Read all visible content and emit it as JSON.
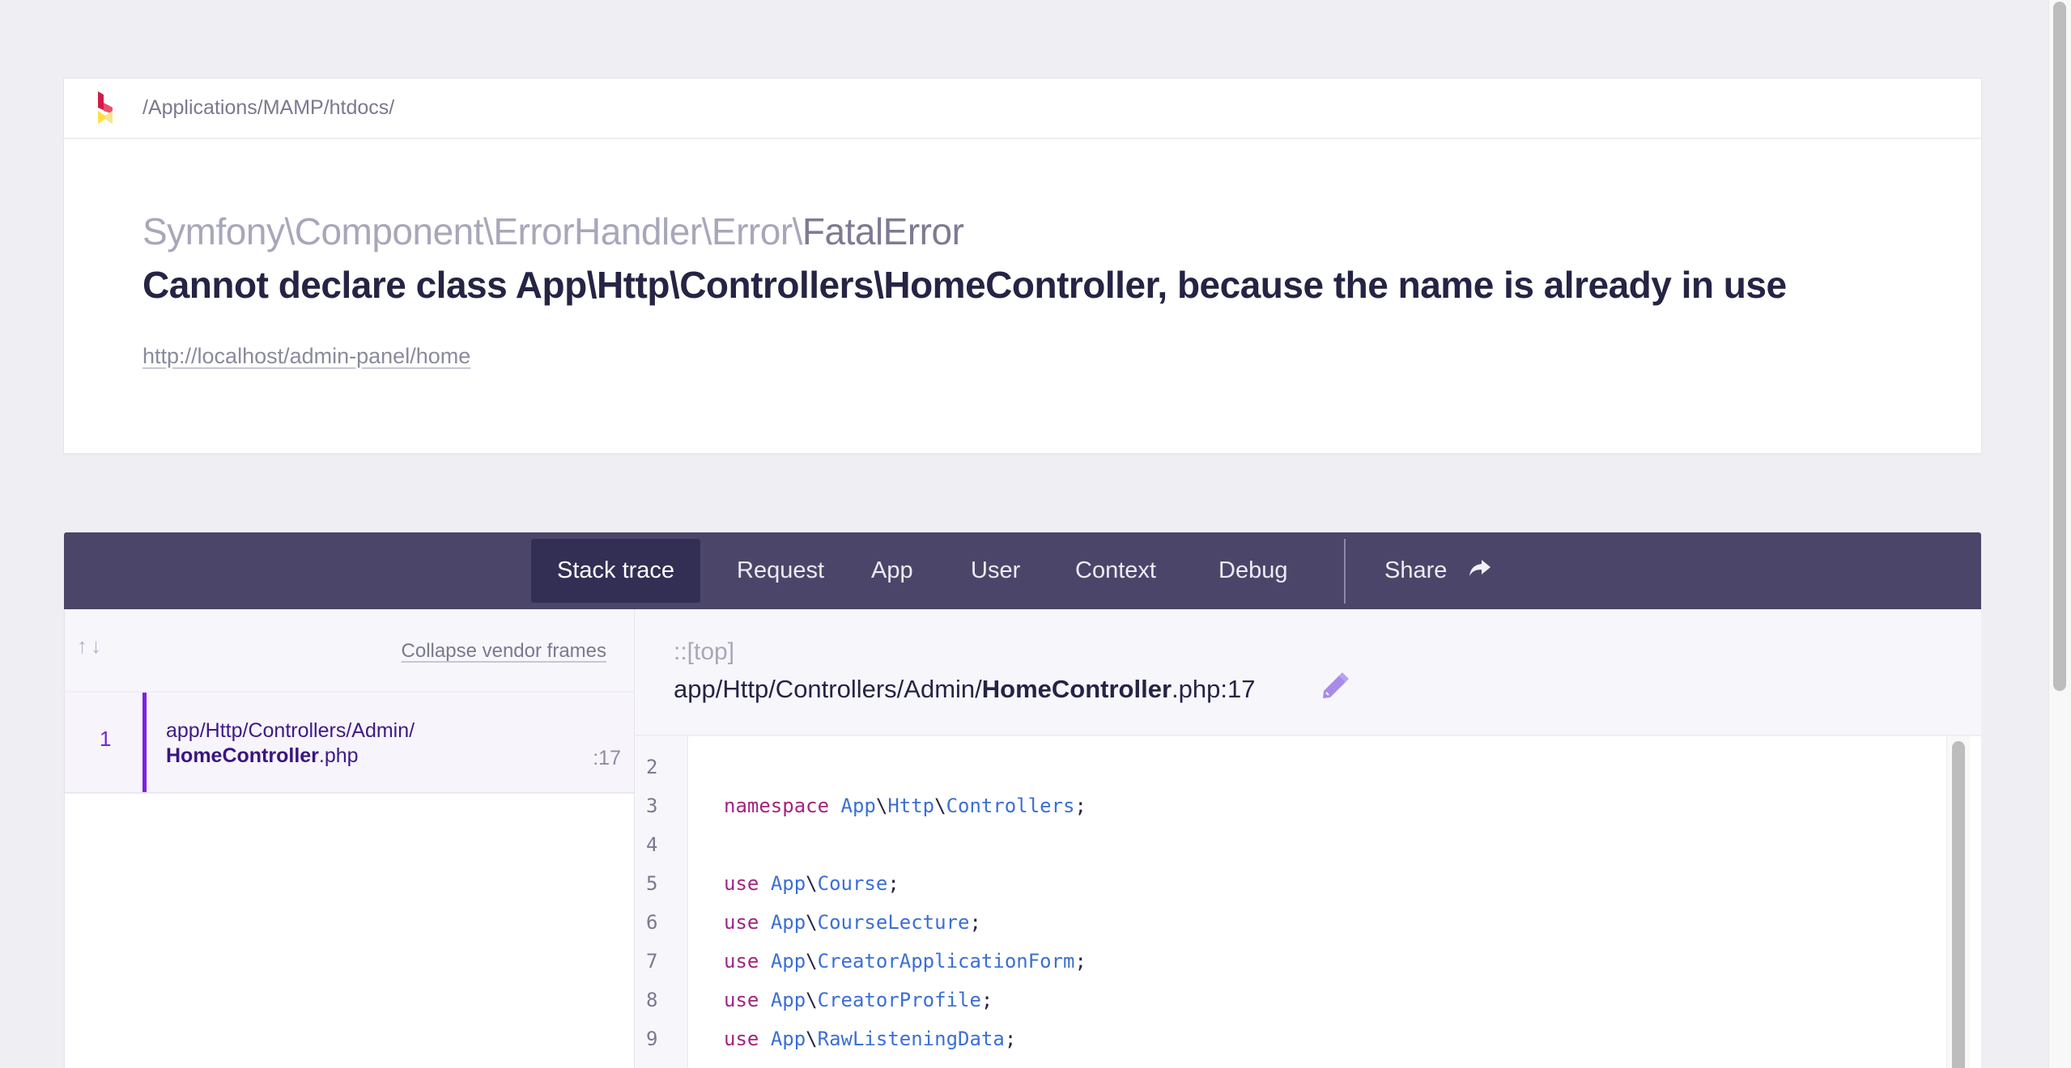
{
  "header": {
    "app_path": "/Applications/MAMP/htdocs/",
    "exception_class_prefix": "Symfony\\Component\\ErrorHandler\\Error\\",
    "exception_class_name": "FatalError",
    "message": "Cannot declare class App\\Http\\Controllers\\HomeController, because the name is already in use",
    "url": "http://localhost/admin-panel/home"
  },
  "nav": {
    "tabs": [
      {
        "label": "Stack trace",
        "active": true
      },
      {
        "label": "Request",
        "active": false
      },
      {
        "label": "App",
        "active": false
      },
      {
        "label": "User",
        "active": false
      },
      {
        "label": "Context",
        "active": false
      },
      {
        "label": "Debug",
        "active": false
      }
    ],
    "share_label": "Share"
  },
  "sidebar": {
    "arrows": "↑↓",
    "collapse_label": "Collapse vendor frames",
    "frames": [
      {
        "number": "1",
        "path": "app/Http/Controllers/Admin/",
        "file_bold": "HomeController",
        "file_ext": ".php",
        "line": ":17"
      }
    ]
  },
  "main": {
    "scope": "::[top]",
    "file_path": "app/Http/Controllers/Admin/",
    "file_bold": "HomeController",
    "file_suffix": ".php:17",
    "code_lines": [
      {
        "n": "2",
        "kw": "",
        "ns": [],
        "end": ""
      },
      {
        "n": "3",
        "kw": "namespace",
        "ns": [
          "App",
          "Http",
          "Controllers"
        ],
        "end": ";"
      },
      {
        "n": "4",
        "kw": "",
        "ns": [],
        "end": ""
      },
      {
        "n": "5",
        "kw": "use",
        "ns": [
          "App",
          "Course"
        ],
        "end": ";"
      },
      {
        "n": "6",
        "kw": "use",
        "ns": [
          "App",
          "CourseLecture"
        ],
        "end": ";"
      },
      {
        "n": "7",
        "kw": "use",
        "ns": [
          "App",
          "CreatorApplicationForm"
        ],
        "end": ";"
      },
      {
        "n": "8",
        "kw": "use",
        "ns": [
          "App",
          "CreatorProfile"
        ],
        "end": ";"
      },
      {
        "n": "9",
        "kw": "use",
        "ns": [
          "App",
          "RawListeningData"
        ],
        "end": ";"
      }
    ]
  },
  "colors": {
    "nav_bg": "#4b4669",
    "nav_active": "#332e54",
    "frame_accent": "#7b22e0",
    "keyword": "#a2247f",
    "namespace": "#3b6fd6"
  }
}
